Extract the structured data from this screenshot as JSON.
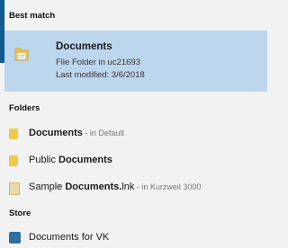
{
  "sections": {
    "best_match": "Best match",
    "folders": "Folders",
    "store": "Store"
  },
  "best_match_item": {
    "title": "Documents",
    "subtitle": "File Folder in uc21693",
    "modified": "Last modified: 3/6/2018",
    "icon": "folder-icon"
  },
  "folder_items": [
    {
      "bold": "Documents",
      "meta": " - in Default",
      "icon": "folder-icon"
    },
    {
      "prefix": "Public ",
      "bold": "Documents",
      "icon": "folder-icon"
    },
    {
      "prefix": "Sample ",
      "bold": "Documents.",
      "suffix": "lnk",
      "meta": " - in Kurzweil 3000",
      "icon": "shortcut-icon"
    }
  ],
  "store_items": [
    {
      "label": "Documents for VK",
      "icon": "app-icon"
    }
  ],
  "colors": {
    "accent": "#0f5a91",
    "highlight": "#bcd6ee",
    "background": "#f2f2f2"
  }
}
